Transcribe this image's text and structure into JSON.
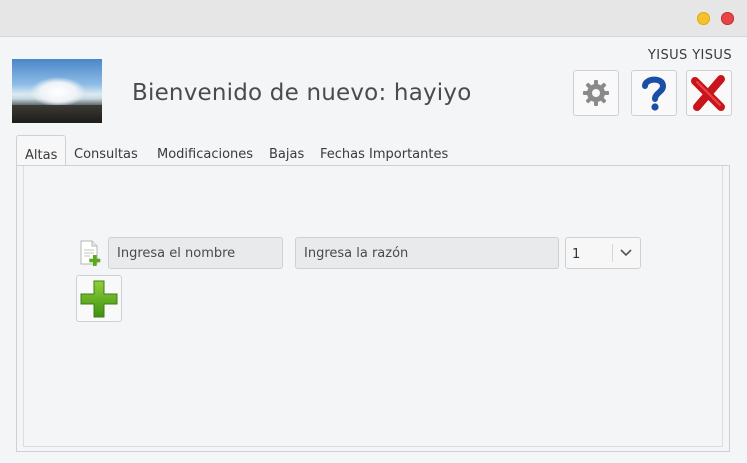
{
  "window": {
    "controls": {
      "minimize_color": "#f6c22c",
      "close_color": "#e84448"
    }
  },
  "header": {
    "welcome_text": "Bienvenido de nuevo: hayiyo",
    "user_name": "YISUS YISUS",
    "image_icon": "coast-waves-photo",
    "buttons": {
      "settings_icon": "gear-icon",
      "help_icon": "question-mark-icon",
      "exit_icon": "red-x-icon"
    }
  },
  "tabs": [
    {
      "label": "Altas",
      "active": true
    },
    {
      "label": "Consultas",
      "active": false
    },
    {
      "label": "Modificaciones",
      "active": false
    },
    {
      "label": "Bajas",
      "active": false
    },
    {
      "label": "Fechas Importantes",
      "active": false
    }
  ],
  "altas_form": {
    "name_placeholder": "Ingresa el nombre",
    "reason_placeholder": "Ingresa la razón",
    "quantity_value": "1",
    "add_icon": "green-plus-icon",
    "doc_icon": "document-add-icon"
  },
  "colors": {
    "accent_green": "#5aa91e",
    "help_blue": "#1a4fa5",
    "exit_red": "#c8141b"
  }
}
